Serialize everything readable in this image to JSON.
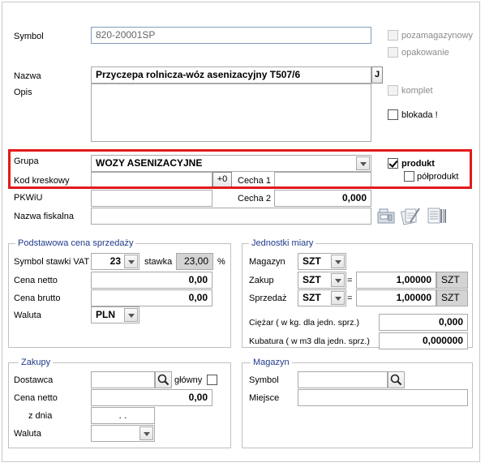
{
  "fields": {
    "symbol_label": "Symbol",
    "symbol_value": "820-20001SP",
    "nazwa_label": "Nazwa",
    "nazwa_value": "Przyczepa rolnicza-wóz asenizacyjny T507/6",
    "nazwa_button": "J",
    "opis_label": "Opis",
    "opis_value": "",
    "grupa_label": "Grupa",
    "grupa_value": "WOZY ASENIZACYJNE",
    "kod_label": "Kod kreskowy",
    "kod_value": "",
    "kod_button": "+0",
    "cecha1_label": "Cecha 1",
    "cecha1_value": "",
    "pkwiu_label": "PKWiU",
    "pkwiu_value": "",
    "cecha2_label": "Cecha 2",
    "cecha2_value": "0,000",
    "fiskalna_label": "Nazwa fiskalna",
    "fiskalna_value": ""
  },
  "flags": {
    "pozamagazynowy": "pozamagazynowy",
    "opakowanie": "opakowanie",
    "komplet": "komplet",
    "blokada": "blokada !",
    "produkt": "produkt",
    "polprodukt": "półprodukt"
  },
  "cena": {
    "title": "Podstawowa cena sprzedaży",
    "vat_label": "Symbol stawki VAT",
    "vat_value": "23",
    "stawka_label": "stawka",
    "stawka_value": "23,00",
    "percent": "%",
    "netto_label": "Cena netto",
    "netto_value": "0,00",
    "brutto_label": "Cena brutto",
    "brutto_value": "0,00",
    "waluta_label": "Waluta",
    "waluta_value": "PLN"
  },
  "jednostki": {
    "title": "Jednostki miary",
    "magazyn_label": "Magazyn",
    "magazyn_value": "SZT",
    "zakup_label": "Zakup",
    "zakup_unit": "SZT",
    "zakup_eq": "=",
    "zakup_ratio": "1,00000",
    "zakup_base": "SZT",
    "sprzedaz_label": "Sprzedaż",
    "sprzedaz_unit": "SZT",
    "sprzedaz_eq": "=",
    "sprzedaz_ratio": "1,00000",
    "sprzedaz_base": "SZT",
    "ciezar_label": "Ciężar ( w kg. dla jedn. sprz.)",
    "ciezar_value": "0,000",
    "kubatura_label": "Kubatura  ( w m3 dla jedn. sprz.)",
    "kubatura_value": "0,000000"
  },
  "zakupy": {
    "title": "Zakupy",
    "dostawca_label": "Dostawca",
    "dostawca_value": "",
    "glowny_label": "główny",
    "netto_label": "Cena netto",
    "netto_value": "0,00",
    "zdnia_label": "z dnia",
    "zdnia_value": ". .",
    "waluta_label": "Waluta",
    "waluta_value": ""
  },
  "magazyn": {
    "title": "Magazyn",
    "symbol_label": "Symbol",
    "symbol_value": "",
    "miejsce_label": "Miejsce",
    "miejsce_value": ""
  },
  "colors": {
    "highlight": "#e31919",
    "group_title": "#1f3a8a"
  }
}
